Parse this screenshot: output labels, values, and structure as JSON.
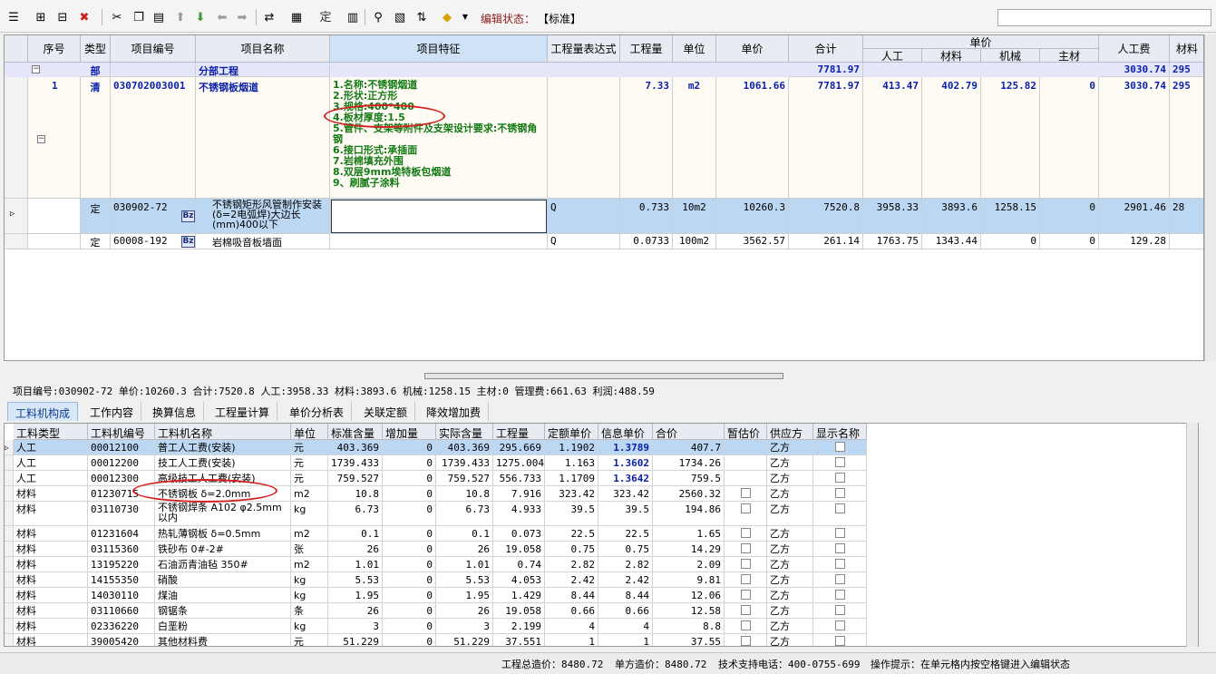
{
  "toolbar": {
    "edit_label": "编辑状态：",
    "edit_value": "【标准】"
  },
  "grid": {
    "headers": {
      "seq": "序号",
      "type": "类型",
      "code": "项目编号",
      "name": "项目名称",
      "feature": "项目特征",
      "expr": "工程量表达式",
      "qty": "工程量",
      "unit": "单位",
      "price": "单价",
      "total": "合计",
      "unit_price_group": "单价",
      "labor": "人工",
      "material": "材料",
      "machine": "机械",
      "main_mat": "主材",
      "labor_fee": "人工费",
      "material_fee": "材料"
    },
    "section": {
      "type": "部",
      "name": "分部工程",
      "total": "7781.97",
      "labor_fee": "3030.74",
      "material_fee": "295"
    },
    "item": {
      "seq": "1",
      "type": "清",
      "code": "030702003001",
      "name": "不锈钢板烟道",
      "qty": "7.33",
      "unit": "m2",
      "price": "1061.66",
      "total": "7781.97",
      "labor": "413.47",
      "material": "402.79",
      "machine": "125.82",
      "main_mat": "0",
      "labor_fee": "3030.74",
      "material_fee": "295",
      "features": [
        "1.名称:不锈钢烟道",
        "2.形状:正方形",
        "3.规格:400*400",
        "4.板材厚度:1.5",
        "5.管件、支架等附件及支架设计要求:不锈钢角钢",
        "6.接口形式:承插面",
        "7.岩棉填充外围",
        "8.双层9mm埃特板包烟道",
        "9、刷腻子涂料"
      ]
    },
    "quota1": {
      "type": "定",
      "code": "030902-72",
      "name": "不锈钢矩形风管制作安装(δ=2电弧焊)大边长(mm)400以下",
      "expr": "Q",
      "qty": "0.733",
      "unit": "10m2",
      "price": "10260.3",
      "total": "7520.8",
      "labor": "3958.33",
      "material": "3893.6",
      "machine": "1258.15",
      "main_mat": "0",
      "labor_fee": "2901.46",
      "material_fee": "28"
    },
    "quota2": {
      "type": "定",
      "code": "60008-192",
      "name": "岩棉吸音板墙面",
      "expr": "Q",
      "qty": "0.0733",
      "unit": "100m2",
      "price": "3562.57",
      "total": "261.14",
      "labor": "1763.75",
      "material": "1343.44",
      "machine": "0",
      "main_mat": "0",
      "labor_fee": "129.28"
    },
    "bz_label": "Bz"
  },
  "info_bar": "项目编号:030902-72  单价:10260.3  合计:7520.8  人工:3958.33  材料:3893.6  机械:1258.15  主材:0  管理费:661.63  利润:488.59",
  "tabs": [
    "工料机构成",
    "工作内容",
    "换算信息",
    "工程量计算",
    "单价分析表",
    "关联定额",
    "降效增加费"
  ],
  "detail": {
    "headers": [
      "工料类型",
      "工料机编号",
      "工料机名称",
      "单位",
      "标准含量",
      "增加量",
      "实际含量",
      "工程量",
      "定额单价",
      "信息单价",
      "合价",
      "暂估价",
      "供应方",
      "显示名称"
    ],
    "rows": [
      [
        "人工",
        "00012100",
        "普工人工费(安装)",
        "元",
        "403.369",
        "0",
        "403.369",
        "295.669",
        "1.1902",
        "1.3789",
        "407.7",
        "",
        "乙方"
      ],
      [
        "人工",
        "00012200",
        "技工人工费(安装)",
        "元",
        "1739.433",
        "0",
        "1739.433",
        "1275.004",
        "1.163",
        "1.3602",
        "1734.26",
        "",
        "乙方"
      ],
      [
        "人工",
        "00012300",
        "高级技工人工费(安装)",
        "元",
        "759.527",
        "0",
        "759.527",
        "556.733",
        "1.1709",
        "1.3642",
        "759.5",
        "",
        "乙方"
      ],
      [
        "材料",
        "01230715",
        "不锈钢板  δ=2.0mm",
        "m2",
        "10.8",
        "0",
        "10.8",
        "7.916",
        "323.42",
        "323.42",
        "2560.32",
        "",
        "乙方"
      ],
      [
        "材料",
        "03110730",
        "不锈钢焊条 A102 φ2.5mm以内",
        "kg",
        "6.73",
        "0",
        "6.73",
        "4.933",
        "39.5",
        "39.5",
        "194.86",
        "",
        "乙方"
      ],
      [
        "材料",
        "01231604",
        "热轧薄钢板  δ=0.5mm",
        "m2",
        "0.1",
        "0",
        "0.1",
        "0.073",
        "22.5",
        "22.5",
        "1.65",
        "",
        "乙方"
      ],
      [
        "材料",
        "03115360",
        "铁砂布 0#-2#",
        "张",
        "26",
        "0",
        "26",
        "19.058",
        "0.75",
        "0.75",
        "14.29",
        "",
        "乙方"
      ],
      [
        "材料",
        "13195220",
        "石油沥青油毡 350#",
        "m2",
        "1.01",
        "0",
        "1.01",
        "0.74",
        "2.82",
        "2.82",
        "2.09",
        "",
        "乙方"
      ],
      [
        "材料",
        "14155350",
        "硝酸",
        "kg",
        "5.53",
        "0",
        "5.53",
        "4.053",
        "2.42",
        "2.42",
        "9.81",
        "",
        "乙方"
      ],
      [
        "材料",
        "14030110",
        "煤油",
        "kg",
        "1.95",
        "0",
        "1.95",
        "1.429",
        "8.44",
        "8.44",
        "12.06",
        "",
        "乙方"
      ],
      [
        "材料",
        "03110660",
        "钢锯条",
        "条",
        "26",
        "0",
        "26",
        "19.058",
        "0.66",
        "0.66",
        "12.58",
        "",
        "乙方"
      ],
      [
        "材料",
        "02336220",
        "白垩粉",
        "kg",
        "3",
        "0",
        "3",
        "2.199",
        "4",
        "4",
        "8.8",
        "",
        "乙方"
      ],
      [
        "材料",
        "39005420",
        "其他材料费",
        "元",
        "51.229",
        "0",
        "51.229",
        "37.551",
        "1",
        "1",
        "37.55",
        "",
        "乙方"
      ]
    ]
  },
  "status": {
    "total_cost": "工程总造价：8480.72",
    "unit_cost": "单方造价：8480.72",
    "support": "技术支持电话：400-0755-699",
    "hint": "操作提示：在单元格内按空格键进入编辑状态"
  },
  "colors": {
    "accent": "#0b3d8c",
    "selected_row": "#bcd7f2",
    "feature_text": "#147a14",
    "highlight": "#d42020"
  }
}
